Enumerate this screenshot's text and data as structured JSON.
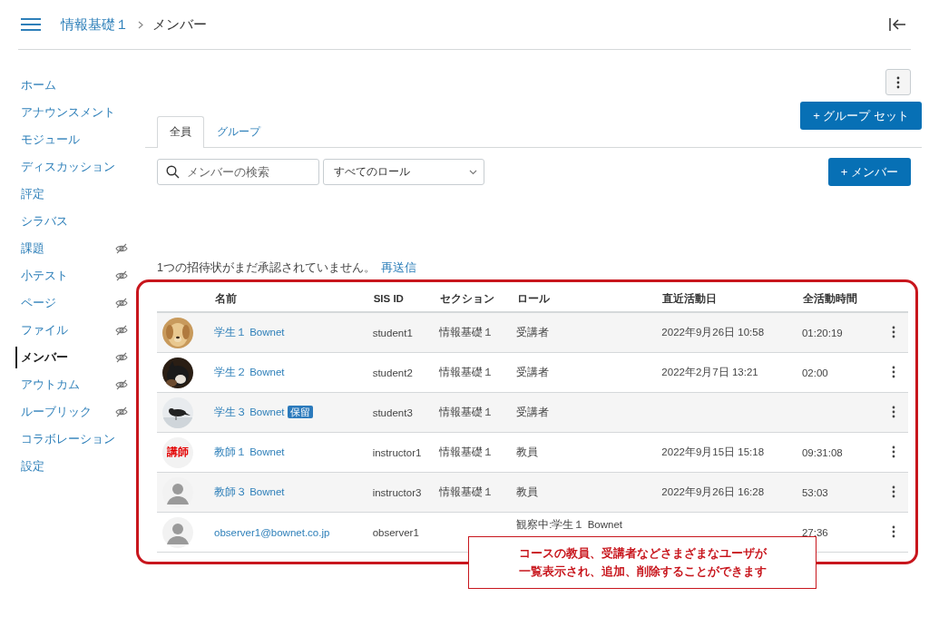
{
  "breadcrumb": {
    "course": "情報基礎１",
    "current": "メンバー"
  },
  "sidebar": {
    "items": [
      {
        "label": "ホーム",
        "selected": false,
        "hidden": false
      },
      {
        "label": "アナウンスメント",
        "selected": false,
        "hidden": false
      },
      {
        "label": "モジュール",
        "selected": false,
        "hidden": false
      },
      {
        "label": "ディスカッション",
        "selected": false,
        "hidden": false
      },
      {
        "label": "評定",
        "selected": false,
        "hidden": false
      },
      {
        "label": "シラバス",
        "selected": false,
        "hidden": false
      },
      {
        "label": "課題",
        "selected": false,
        "hidden": true
      },
      {
        "label": "小テスト",
        "selected": false,
        "hidden": true
      },
      {
        "label": "ページ",
        "selected": false,
        "hidden": true
      },
      {
        "label": "ファイル",
        "selected": false,
        "hidden": true
      },
      {
        "label": "メンバー",
        "selected": true,
        "hidden": true
      },
      {
        "label": "アウトカム",
        "selected": false,
        "hidden": true
      },
      {
        "label": "ルーブリック",
        "selected": false,
        "hidden": true
      },
      {
        "label": "コラボレーション",
        "selected": false,
        "hidden": false
      },
      {
        "label": "設定",
        "selected": false,
        "hidden": false
      }
    ]
  },
  "tabs": [
    {
      "label": "全員",
      "selected": true
    },
    {
      "label": "グループ",
      "selected": false
    }
  ],
  "group_set_button": "+ グループ セット",
  "search": {
    "placeholder": "メンバーの検索"
  },
  "role_filter": {
    "value": "すべてのロール"
  },
  "add_member_button": "+ メンバー",
  "notice": {
    "text": "1つの招待状がまだ承認されていません。",
    "link": "再送信"
  },
  "table": {
    "columns": [
      "名前",
      "SIS ID",
      "セクション",
      "ロール",
      "直近活動日",
      "全活動時間"
    ],
    "rows": [
      {
        "name": "学生１ Bownet",
        "sis_id": "student1",
        "section": "情報基礎１",
        "role": "受講者",
        "last_activity": "2022年9月26日 10:58",
        "total_activity": "01:20:19"
      },
      {
        "name": "学生２ Bownet",
        "sis_id": "student2",
        "section": "情報基礎１",
        "role": "受講者",
        "last_activity": "2022年2月7日 13:21",
        "total_activity": "02:00"
      },
      {
        "name": "学生３ Bownet",
        "badge": "保留",
        "sis_id": "student3",
        "section": "情報基礎１",
        "role": "受講者"
      },
      {
        "avatar": {
          "kind": "text",
          "text": "講師"
        },
        "name": "教師１ Bownet",
        "sis_id": "instructor1",
        "section": "情報基礎１",
        "role": "教員",
        "last_activity": "2022年9月15日 15:18",
        "total_activity": "09:31:08"
      },
      {
        "avatar": {
          "kind": "default"
        },
        "name": "教師３ Bownet",
        "sis_id": "instructor3",
        "section": "情報基礎１",
        "role": "教員",
        "last_activity": "2022年9月26日 16:28",
        "total_activity": "53:03"
      },
      {
        "avatar": {
          "kind": "default"
        },
        "name": "observer1@bownet.co.jp",
        "sis_id": "observer1",
        "role": "観察中:学生１ Bownet",
        "total_activity": "27:36"
      }
    ]
  },
  "callout": {
    "lines": [
      "コースの教員、受講者などさまざまなユーザが",
      "一覧表示され、追加、削除することができます"
    ]
  }
}
